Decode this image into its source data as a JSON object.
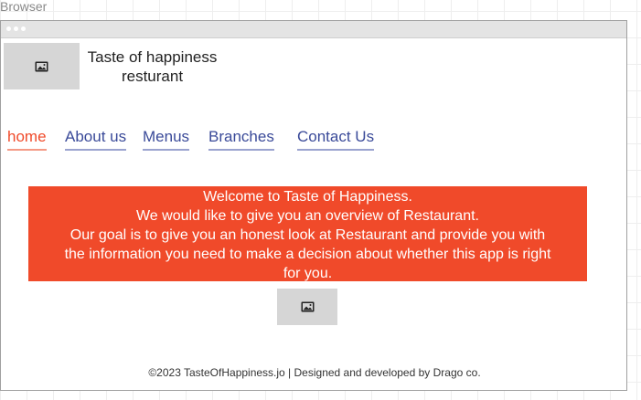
{
  "canvas": {
    "label": "Browser"
  },
  "header": {
    "logo_icon": "image-placeholder-icon",
    "brand_line1": "Taste of happiness",
    "brand_line2": "resturant"
  },
  "nav": {
    "items": [
      {
        "label": "home",
        "active": true
      },
      {
        "label": "About us",
        "active": false
      },
      {
        "label": "Menus",
        "active": false
      },
      {
        "label": "Branches",
        "active": false
      },
      {
        "label": "Contact Us",
        "active": false
      }
    ]
  },
  "welcome": {
    "lines": [
      "Welcome to Taste of Happiness.",
      "We would like to give you an overview of Restaurant.",
      "Our goal is to give you an honest look at Restaurant and provide you with",
      "the information you need to make a decision about whether this app is right",
      "for you."
    ]
  },
  "content_image": {
    "icon": "image-placeholder-icon"
  },
  "footer": {
    "text": "©2023 TasteOfHappiness.jo | Designed and developed by Drago co."
  },
  "colors": {
    "accent": "#f04a2a",
    "nav_link": "#3a4a99",
    "placeholder": "#d6d6d6"
  }
}
